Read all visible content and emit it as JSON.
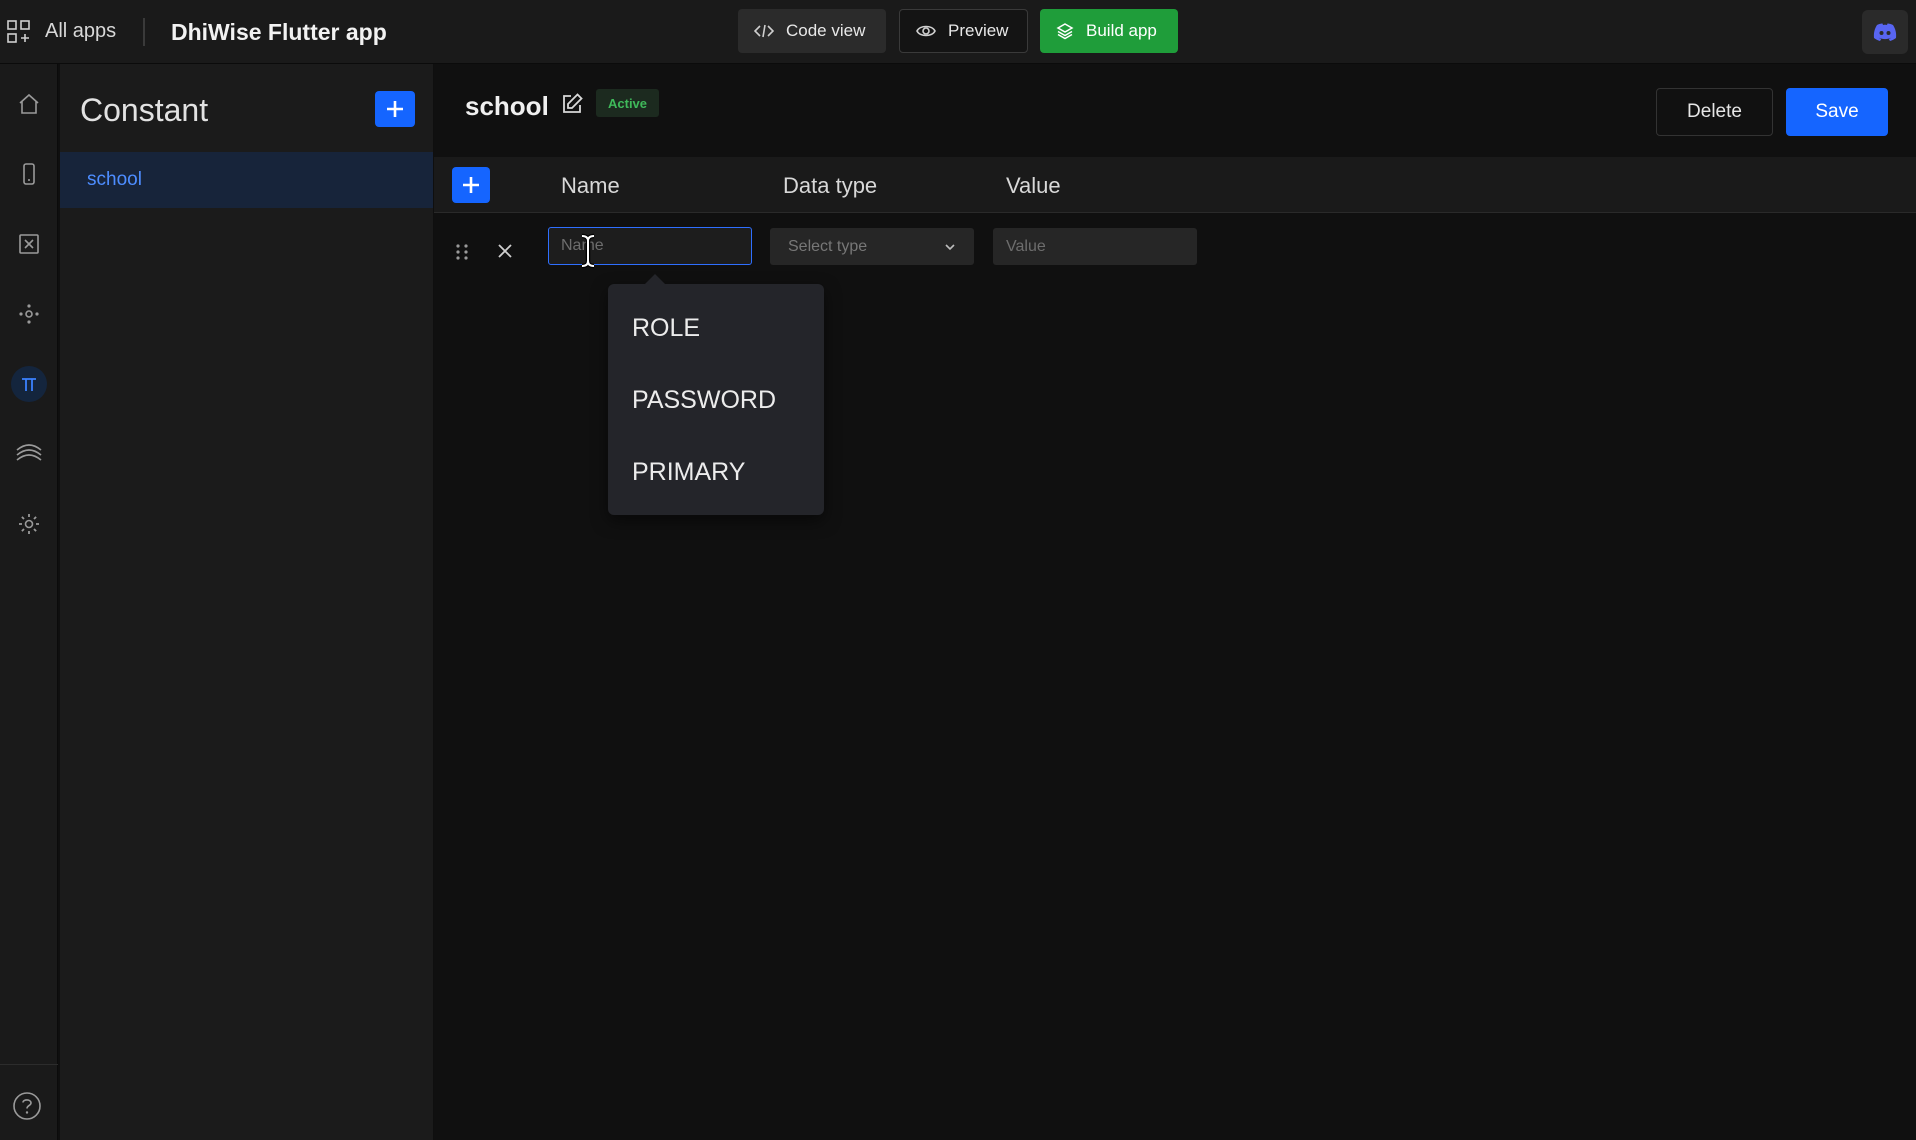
{
  "topbar": {
    "all_apps": "All apps",
    "app_title": "DhiWise Flutter app",
    "code_view": "Code view",
    "preview": "Preview",
    "build_app": "Build app"
  },
  "sidebar": {
    "items": [
      {
        "icon": "home-icon"
      },
      {
        "icon": "mobile-screen-icon"
      },
      {
        "icon": "excel-icon"
      },
      {
        "icon": "integration-hub-icon"
      },
      {
        "icon": "constant-pi-icon",
        "active": true
      },
      {
        "icon": "layers-icon"
      },
      {
        "icon": "gear-icon"
      }
    ],
    "help_icon": "help-icon"
  },
  "panel": {
    "title": "Constant",
    "items": [
      {
        "label": "school",
        "selected": true
      }
    ]
  },
  "main": {
    "group_name": "school",
    "status_badge": "Active",
    "delete_label": "Delete",
    "save_label": "Save",
    "columns": {
      "name": "Name",
      "data_type": "Data type",
      "value": "Value"
    },
    "row": {
      "name_placeholder": "Name",
      "name_value": "",
      "type_placeholder": "Select type",
      "value_placeholder": "Value"
    },
    "suggestions": [
      "ROLE",
      "PASSWORD",
      "PRIMARY"
    ]
  },
  "colors": {
    "accent": "#1565ff",
    "build": "#1f9d3a",
    "active_badge": "#3fb95a",
    "background": "#101010"
  }
}
